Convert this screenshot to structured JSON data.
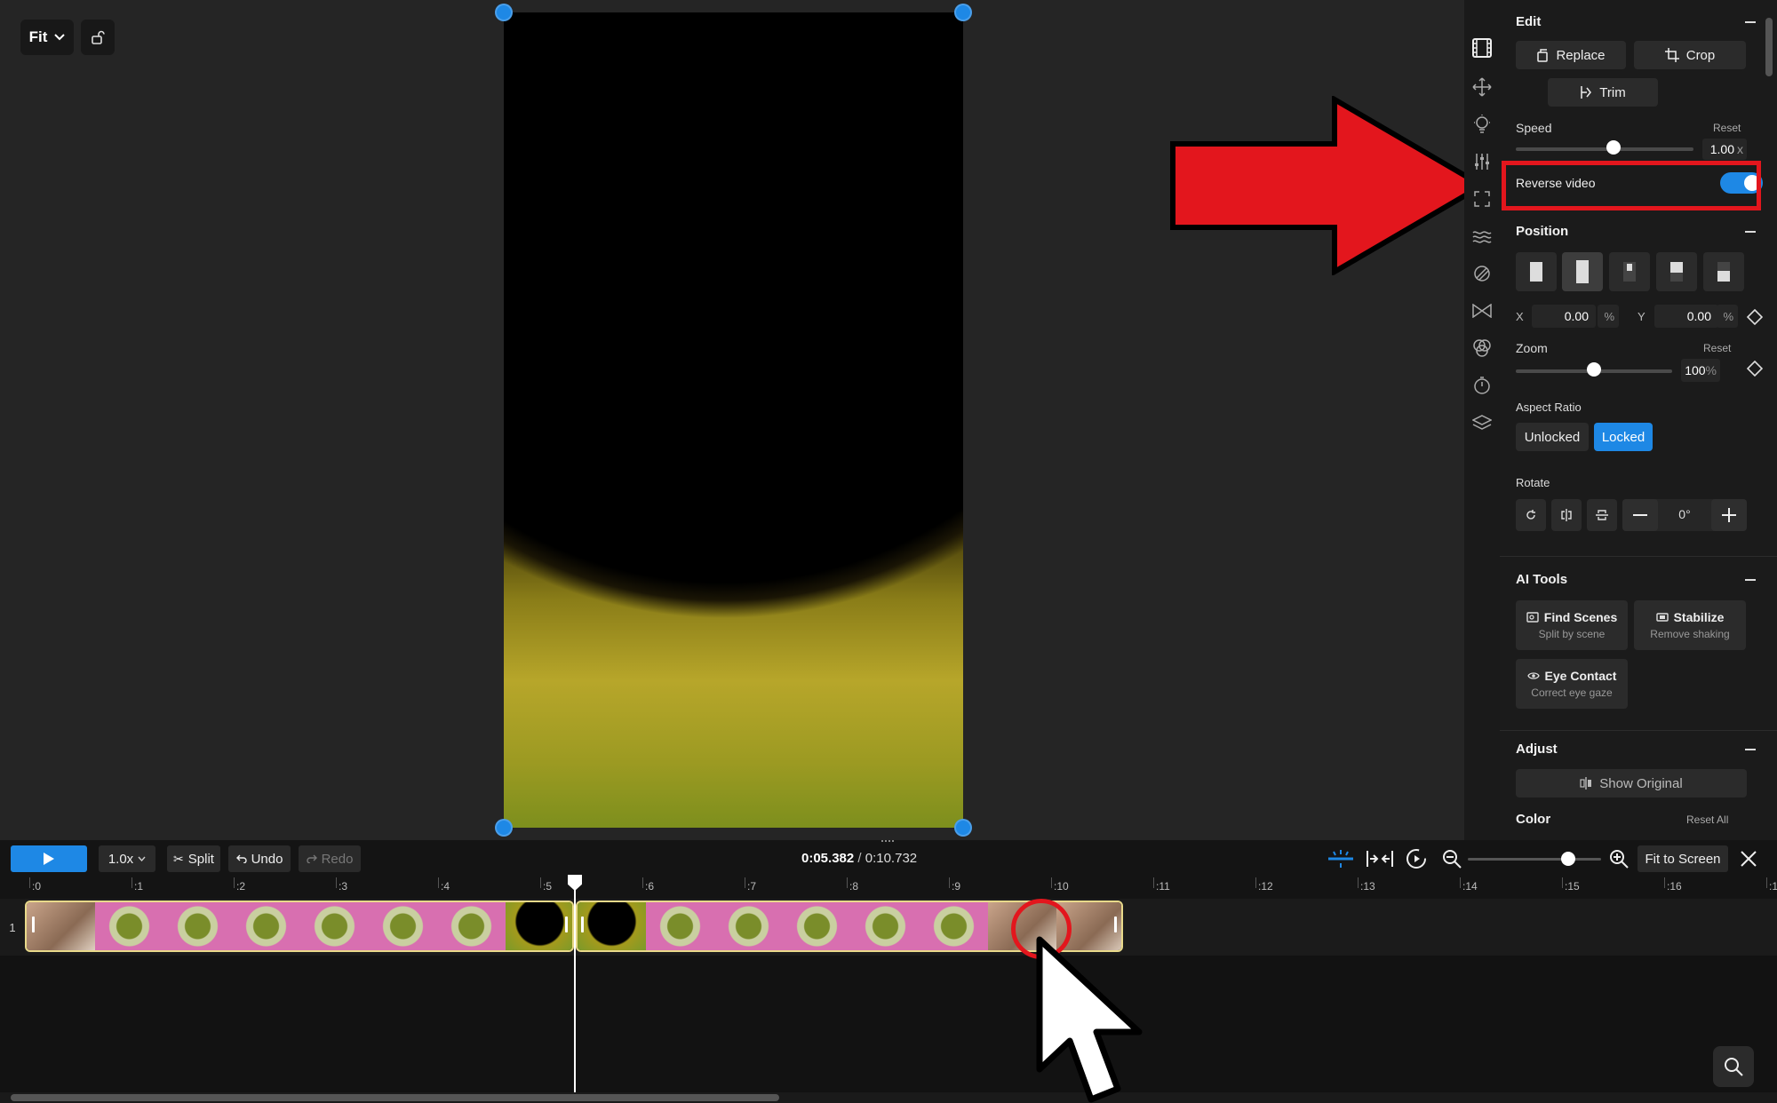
{
  "preview": {
    "fit_label": "Fit"
  },
  "panel": {
    "edit": {
      "title": "Edit",
      "replace_label": "Replace",
      "crop_label": "Crop",
      "trim_label": "Trim"
    },
    "speed": {
      "label": "Speed",
      "reset_label": "Reset",
      "value": "1.00",
      "unit": "x",
      "slider_fraction": 0.55
    },
    "reverse": {
      "label": "Reverse video",
      "enabled": true
    },
    "position": {
      "title": "Position",
      "x_label": "X",
      "x_value": "0.00",
      "y_label": "Y",
      "y_value": "0.00",
      "percent": "%"
    },
    "zoom": {
      "label": "Zoom",
      "reset_label": "Reset",
      "value": "100",
      "unit": "%",
      "slider_fraction": 0.5
    },
    "aspect": {
      "label": "Aspect Ratio",
      "unlocked_label": "Unlocked",
      "locked_label": "Locked",
      "selected": "Locked"
    },
    "rotate": {
      "label": "Rotate",
      "value": "0°"
    },
    "ai_tools": {
      "title": "AI Tools",
      "find_scenes": "Find Scenes",
      "find_scenes_sub": "Split by scene",
      "stabilize": "Stabilize",
      "stabilize_sub": "Remove shaking",
      "eye_contact": "Eye Contact",
      "eye_contact_sub": "Correct eye gaze"
    },
    "adjust": {
      "title": "Adjust",
      "show_original": "Show Original",
      "color_label": "Color",
      "reset_all": "Reset All"
    }
  },
  "timeline": {
    "speed_label": "1.0x",
    "split_label": "Split",
    "undo_label": "Undo",
    "redo_label": "Redo",
    "current_time": "0:05.382",
    "separator": " / ",
    "total_time": "0:10.732",
    "fit_to_screen": "Fit to Screen",
    "track_number": "1",
    "ticks": [
      ":0",
      ":1",
      ":2",
      ":3",
      ":4",
      ":5",
      ":6",
      ":7",
      ":8",
      ":9",
      ":10",
      ":11",
      ":12",
      ":13",
      ":14",
      ":15",
      ":16",
      ":1"
    ],
    "zoom_fraction": 0.75
  },
  "colors": {
    "accent": "#1e88e5",
    "annotation_red": "#e3161d",
    "clip_border": "#e8d98a"
  }
}
